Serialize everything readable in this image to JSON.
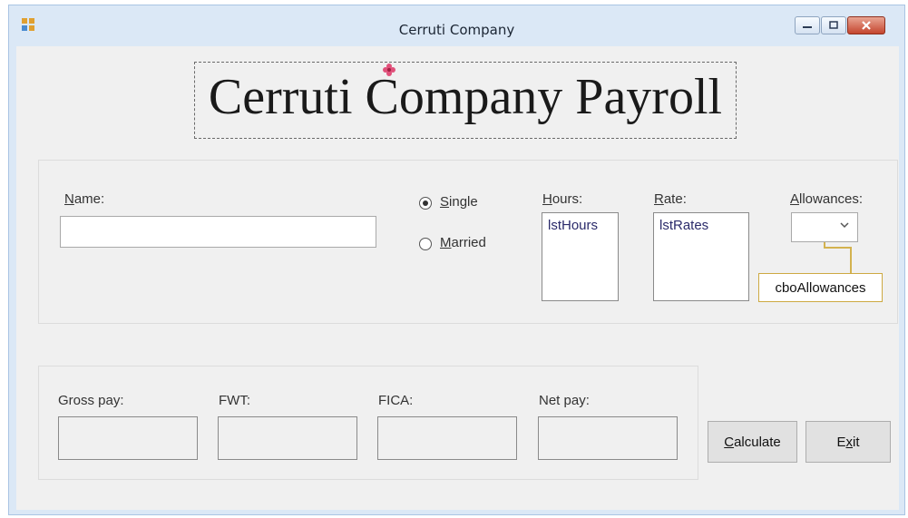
{
  "window": {
    "title": "Cerruti Company"
  },
  "heading": {
    "text": "Cerruti Company Payroll"
  },
  "form": {
    "name_label_mnemonic": "N",
    "name_label_rest": "ame:",
    "name_value": "",
    "single_mnemonic": "S",
    "single_rest": "ingle",
    "married_mnemonic": "M",
    "married_rest": "arried",
    "marital_status_selected": "Single",
    "hours_label_mnemonic": "H",
    "hours_label_rest": "ours:",
    "hours_list_item": "lstHours",
    "rate_label_mnemonic": "R",
    "rate_label_rest": "ate:",
    "rates_list_item": "lstRates",
    "allowances_label_mnemonic": "A",
    "allowances_label_rest": "llowances:",
    "allowances_callout": "cboAllowances"
  },
  "output": {
    "gross_pay_label": "Gross pay:",
    "fwt_label": "FWT:",
    "fica_label": "FICA:",
    "net_pay_label": "Net pay:",
    "gross_pay_value": "",
    "fwt_value": "",
    "fica_value": "",
    "net_pay_value": ""
  },
  "buttons": {
    "calculate_mnemonic": "C",
    "calculate_rest": "alculate",
    "exit_before": "E",
    "exit_mnemonic": "x",
    "exit_after": "it"
  },
  "colors": {
    "title_bar": "#dbe8f6",
    "client": "#f0f0f0",
    "close_button": "#c4452e",
    "callout_border": "#cda942"
  }
}
